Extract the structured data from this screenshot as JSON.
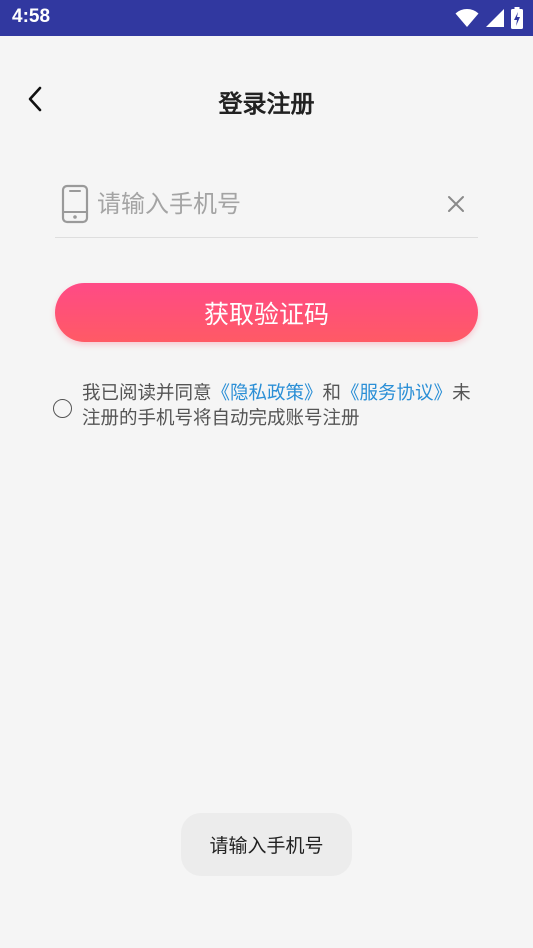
{
  "status_bar": {
    "time": "4:58",
    "icons": [
      "wifi-icon",
      "signal-icon",
      "battery-charging-icon"
    ]
  },
  "header": {
    "title": "登录注册",
    "back_icon": "chevron-left-icon"
  },
  "phone_field": {
    "placeholder": "请输入手机号",
    "value": "",
    "icon": "phone-icon",
    "clear_icon": "close-icon"
  },
  "get_code_button": {
    "label": "获取验证码",
    "gradient": [
      "#ff4a86",
      "#ff5a65"
    ]
  },
  "agreement": {
    "checked": false,
    "prefix": "我已阅读并同意",
    "privacy_link": "《隐私政策》",
    "and": "和",
    "service_link": "《服务协议》",
    "suffix": "未注册的手机号将自动完成账号注册",
    "link_color": "#2b8fd6"
  },
  "toast": {
    "text": "请输入手机号"
  },
  "colors": {
    "status_bar": "#3138a0",
    "background": "#f5f5f5"
  }
}
